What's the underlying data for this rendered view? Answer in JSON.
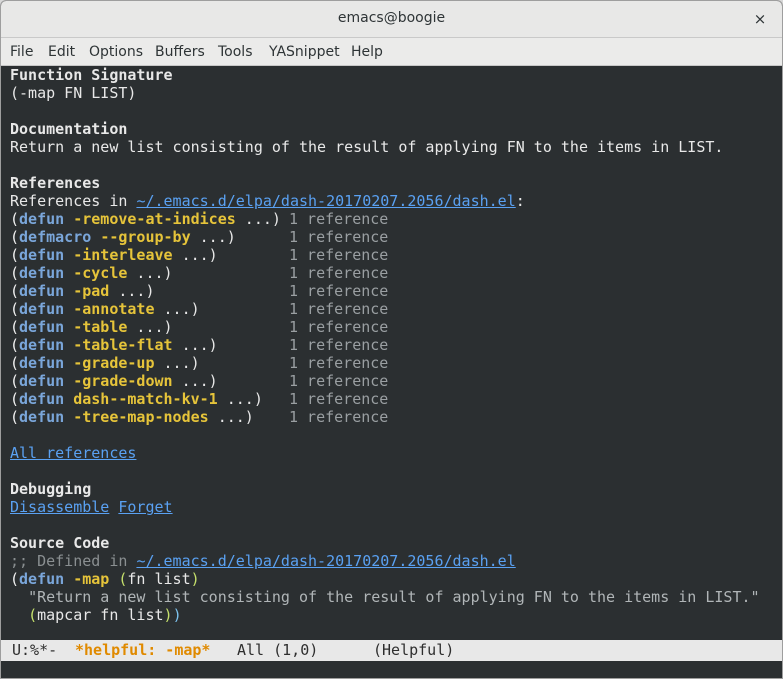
{
  "window": {
    "title": "emacs@boogie",
    "close_glyph": "×"
  },
  "menubar": {
    "items": [
      "File",
      "Edit",
      "Options",
      "Buffers",
      "Tools",
      "YASnippet",
      "Help"
    ]
  },
  "buffer": {
    "signature_heading": "Function Signature",
    "signature": "(-map FN LIST)",
    "documentation_heading": "Documentation",
    "documentation": "Return a new list consisting of the result of applying FN to the items in LIST.",
    "references_heading": "References",
    "references_prefix": "References in ",
    "references_path": "~/.emacs.d/elpa/dash-20170207.2056/dash.el",
    "references_suffix": ":",
    "reference_rows": [
      {
        "open": "(",
        "kind": "defun",
        "name": "-remove-at-indices",
        "rest": " ...)",
        "count": "1 reference"
      },
      {
        "open": "(",
        "kind": "defmacro",
        "name": "--group-by",
        "rest": " ...)",
        "count": "1 reference"
      },
      {
        "open": "(",
        "kind": "defun",
        "name": "-interleave",
        "rest": " ...)",
        "count": "1 reference"
      },
      {
        "open": "(",
        "kind": "defun",
        "name": "-cycle",
        "rest": " ...)",
        "count": "1 reference"
      },
      {
        "open": "(",
        "kind": "defun",
        "name": "-pad",
        "rest": " ...)",
        "count": "1 reference"
      },
      {
        "open": "(",
        "kind": "defun",
        "name": "-annotate",
        "rest": " ...)",
        "count": "1 reference"
      },
      {
        "open": "(",
        "kind": "defun",
        "name": "-table",
        "rest": " ...)",
        "count": "1 reference"
      },
      {
        "open": "(",
        "kind": "defun",
        "name": "-table-flat",
        "rest": " ...)",
        "count": "1 reference"
      },
      {
        "open": "(",
        "kind": "defun",
        "name": "-grade-up",
        "rest": " ...)",
        "count": "1 reference"
      },
      {
        "open": "(",
        "kind": "defun",
        "name": "-grade-down",
        "rest": " ...)",
        "count": "1 reference"
      },
      {
        "open": "(",
        "kind": "defun",
        "name": "dash--match-kv-1",
        "rest": " ...)",
        "count": "1 reference"
      },
      {
        "open": "(",
        "kind": "defun",
        "name": "-tree-map-nodes",
        "rest": " ...)",
        "count": "1 reference"
      }
    ],
    "all_references": "All references",
    "debugging_heading": "Debugging",
    "disassemble": "Disassemble",
    "forget": "Forget",
    "source_heading": "Source Code",
    "source_comment_prefix": ";; Defined in ",
    "source_path": "~/.emacs.d/elpa/dash-20170207.2056/dash.el",
    "source_line1": {
      "open": "(",
      "kind": "defun",
      "name": "-map",
      "args_open": "(",
      "args": "fn list",
      "args_close": ")"
    },
    "source_line2": "\"Return a new list consisting of the result of applying FN to the items in LIST.\"",
    "source_line3": {
      "open": "(",
      "body": "mapcar fn list",
      "close_inner": ")",
      "close_outer": ")"
    }
  },
  "modeline": {
    "status": "U:%*-",
    "buffer_name": "*helpful: -map*",
    "position": "All (1,0)",
    "mode": "(Helpful)"
  },
  "colors": {
    "background": "#2b2f31",
    "keyword": "#7aa6da",
    "function_name": "#e6c43a",
    "link": "#5aa1f2",
    "modeline_buffer": "#e08a00"
  }
}
